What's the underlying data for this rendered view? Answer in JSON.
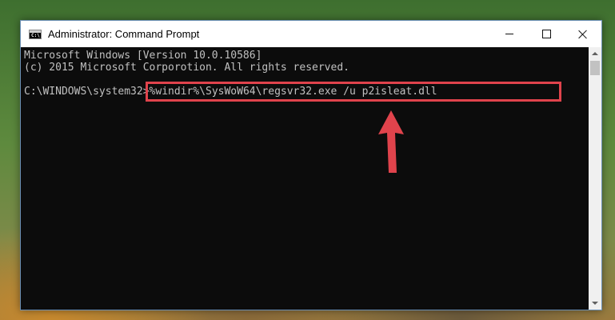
{
  "window": {
    "title": "Administrator: Command Prompt",
    "icon": "cmd-icon",
    "icon_glyph": "C:\\"
  },
  "console": {
    "lines": [
      "Microsoft Windows [Version 10.0.10586]",
      "(c) 2015 Microsoft Corporotion. All rights reserved."
    ],
    "prompt": "C:\\WINDOWS\\system32>",
    "command": "%windir%\\SysWoW64\\regsvr32.exe /u p2isleat.dll"
  },
  "colors": {
    "console_bg": "#0c0c0c",
    "console_text": "#c0c0c0",
    "highlight": "#e0434c",
    "arrow": "#e0434c"
  },
  "annotation": {
    "icon": "red-arrow-icon"
  }
}
